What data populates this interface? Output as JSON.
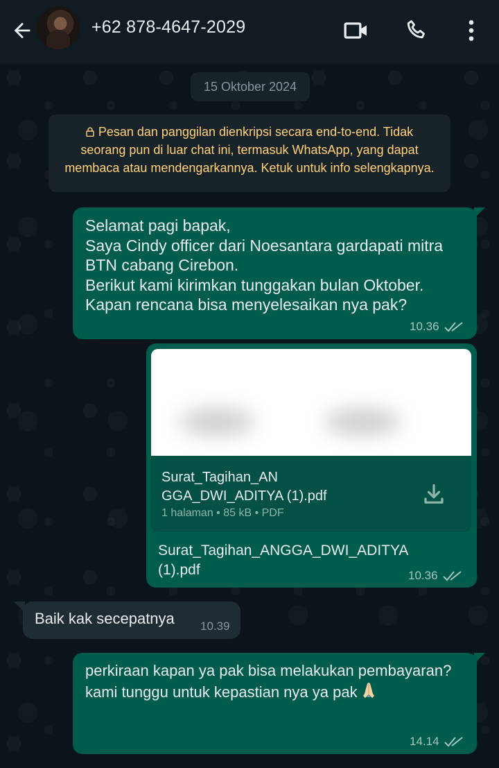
{
  "header": {
    "contact": "+62 878-4647-2029",
    "icons": [
      "back-arrow-icon",
      "video-call-icon",
      "voice-call-icon",
      "more-options-icon"
    ]
  },
  "chat": {
    "date_chip": "15 Oktober 2024",
    "encryption_notice": "Pesan dan panggilan dienkripsi secara end-to-end. Tidak seorang pun di luar chat ini, termasuk WhatsApp, yang dapat membaca atau mendengarkannya. Ketuk untuk info selengkapnya.",
    "messages": [
      {
        "direction": "outgoing",
        "text": "Selamat pagi bapak,\nSaya Cindy officer dari Noesantara gardapati mitra BTN cabang Cirebon.\nBerikut kami kirimkan tunggakan bulan Oktober.\nKapan rencana bisa menyelesaikan nya pak?",
        "time": "10.36",
        "status": "read"
      },
      {
        "direction": "outgoing",
        "type": "document",
        "doc_name": "Surat_Tagihan_AN GGA_DWI_ADITYA (1).pdf",
        "doc_meta": "1 halaman • 85 kB • PDF",
        "caption": "Surat_Tagihan_ANGGA_DWI_ADITYA (1).pdf",
        "time": "10.36",
        "status": "read"
      },
      {
        "direction": "incoming",
        "text": "Baik kak secepatnya",
        "time": "10.39"
      },
      {
        "direction": "outgoing",
        "text": "perkiraan kapan ya pak bisa melakukan pembayaran?\nkami tunggu untuk kepastian nya ya pak",
        "emoji": "🙏",
        "time": "14.14",
        "status": "read"
      }
    ]
  },
  "colors": {
    "header_bg": "#111b21",
    "chat_bg": "#0b141a",
    "outgoing_bubble": "#005c4b",
    "incoming_bubble": "#202c33",
    "notice_text": "#ffd279",
    "read_ticks": "#a8c5bd"
  }
}
